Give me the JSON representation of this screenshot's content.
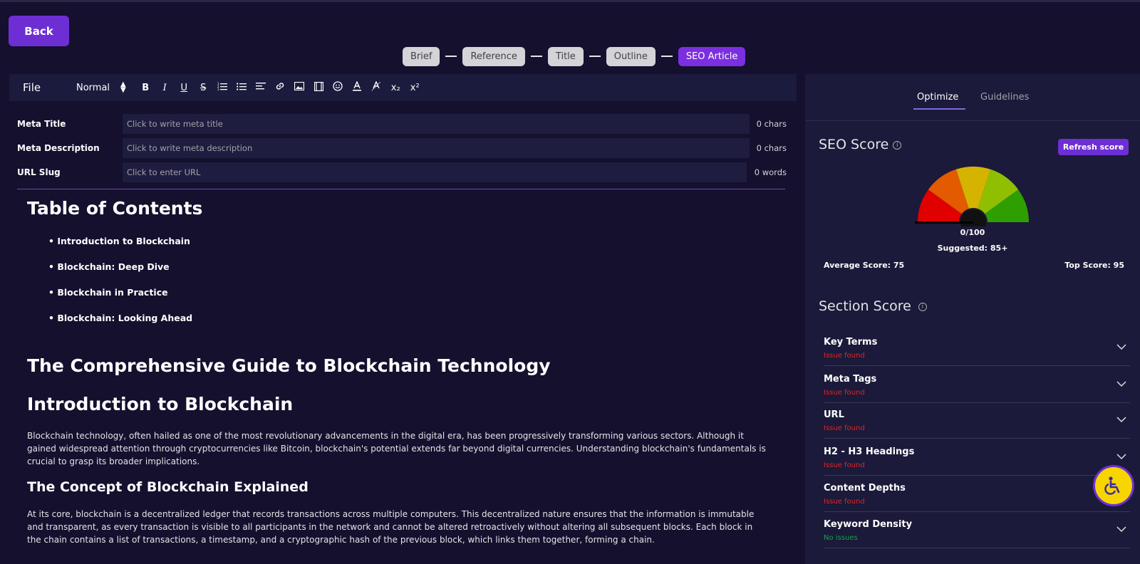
{
  "back_label": "Back",
  "steps": [
    "Brief",
    "Reference",
    "Title",
    "Outline",
    "SEO Article"
  ],
  "toolbar": {
    "file_label": "File",
    "style_select": "Normal",
    "tools": [
      "B",
      "I",
      "U",
      "S",
      "ordered-list",
      "bullet-list",
      "align",
      "link",
      "image",
      "video",
      "emoji",
      "text-color",
      "clear-format",
      "x₂",
      "x²"
    ]
  },
  "meta": {
    "title_label": "Meta Title",
    "title_placeholder": "Click to write meta title",
    "title_count": "0 chars",
    "desc_label": "Meta Description",
    "desc_placeholder": "Click to write meta description",
    "desc_count": "0 chars",
    "slug_label": "URL Slug",
    "slug_placeholder": "Click to enter URL",
    "slug_count": "0 words"
  },
  "article": {
    "toc_heading": "Table of Contents",
    "toc_items": [
      "Introduction to Blockchain",
      "Blockchain: Deep Dive",
      "Blockchain in Practice",
      "Blockchain: Looking Ahead"
    ],
    "main_title": "The Comprehensive Guide to Blockchain Technology",
    "intro_heading": "Introduction to Blockchain",
    "intro_para": "Blockchain technology, often hailed as one of the most revolutionary advancements in the digital era, has been progressively transforming various sectors. Although it gained widespread attention through cryptocurrencies like Bitcoin, blockchain's potential extends far beyond digital currencies. Understanding blockchain's fundamentals is crucial to grasp its broader implications.",
    "concept_heading": "The Concept of Blockchain Explained",
    "concept_para": "At its core, blockchain is a decentralized ledger that records transactions across multiple computers. This decentralized nature ensures that the information is immutable and transparent, as every transaction is visible to all participants in the network and cannot be altered retroactively without altering all subsequent blocks. Each block in the chain contains a list of transactions, a timestamp, and a cryptographic hash of the previous block, which links them together, forming a chain."
  },
  "panel": {
    "tab_optimize": "Optimize",
    "tab_guidelines": "Guidelines",
    "seo_title": "SEO Score",
    "refresh_label": "Refresh score",
    "score": "0/100",
    "suggested": "Suggested: 85+",
    "average": "Average Score: 75",
    "top": "Top Score: 95",
    "gauge_colors": [
      "#e00000",
      "#e35a00",
      "#d4b400",
      "#8fbf00",
      "#2e9e00"
    ],
    "section_title": "Section Score",
    "sections": [
      {
        "name": "Key Terms",
        "status": "Issue found",
        "ok": false
      },
      {
        "name": "Meta Tags",
        "status": "Issue found",
        "ok": false
      },
      {
        "name": "URL",
        "status": "Issue found",
        "ok": false
      },
      {
        "name": "H2 - H3 Headings",
        "status": "Issue found",
        "ok": false
      },
      {
        "name": "Content Depths",
        "status": "Issue found",
        "ok": false
      },
      {
        "name": "Keyword Density",
        "status": "No issues",
        "ok": true
      }
    ]
  }
}
